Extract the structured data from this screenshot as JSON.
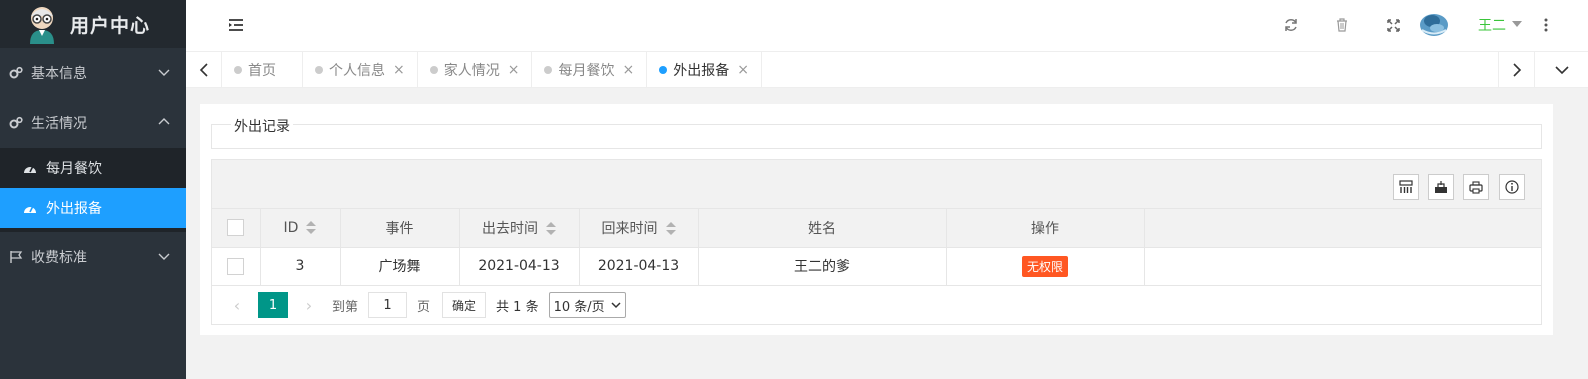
{
  "app": {
    "title": "用户中心"
  },
  "sidebar": {
    "menus": [
      {
        "label": "基本信息",
        "expanded": false
      },
      {
        "label": "生活情况",
        "expanded": true,
        "children": [
          {
            "label": "每月餐饮",
            "active": false
          },
          {
            "label": "外出报备",
            "active": true
          }
        ]
      },
      {
        "label": "收费标准",
        "expanded": false
      }
    ]
  },
  "header": {
    "user_name": "王二",
    "icons": [
      "menu-toggle-icon",
      "refresh-icon",
      "trash-icon",
      "fullscreen-icon",
      "more-icon"
    ]
  },
  "tabs": [
    {
      "label": "首页",
      "closable": false,
      "active": false
    },
    {
      "label": "个人信息",
      "closable": true,
      "active": false
    },
    {
      "label": "家人情况",
      "closable": true,
      "active": false
    },
    {
      "label": "每月餐饮",
      "closable": true,
      "active": false
    },
    {
      "label": "外出报备",
      "closable": true,
      "active": true
    }
  ],
  "section": {
    "legend": "外出记录"
  },
  "table": {
    "columns": [
      "ID",
      "事件",
      "出去时间",
      "回来时间",
      "姓名",
      "操作"
    ],
    "rows": [
      {
        "id": "3",
        "event": "广场舞",
        "out_time": "2021-04-13",
        "back_time": "2021-04-13",
        "name": "王二的爹",
        "action": "无权限"
      }
    ]
  },
  "pager": {
    "current": "1",
    "goto_label": "到第",
    "goto_value": "1",
    "page_label": "页",
    "confirm": "确定",
    "total": "共 1 条",
    "page_size": "10 条/页"
  },
  "colors": {
    "accent": "#1e9fff",
    "sidebar": "#2b333b",
    "pager_active": "#009688",
    "badge": "#ff5722",
    "user": "#3ac53a"
  }
}
